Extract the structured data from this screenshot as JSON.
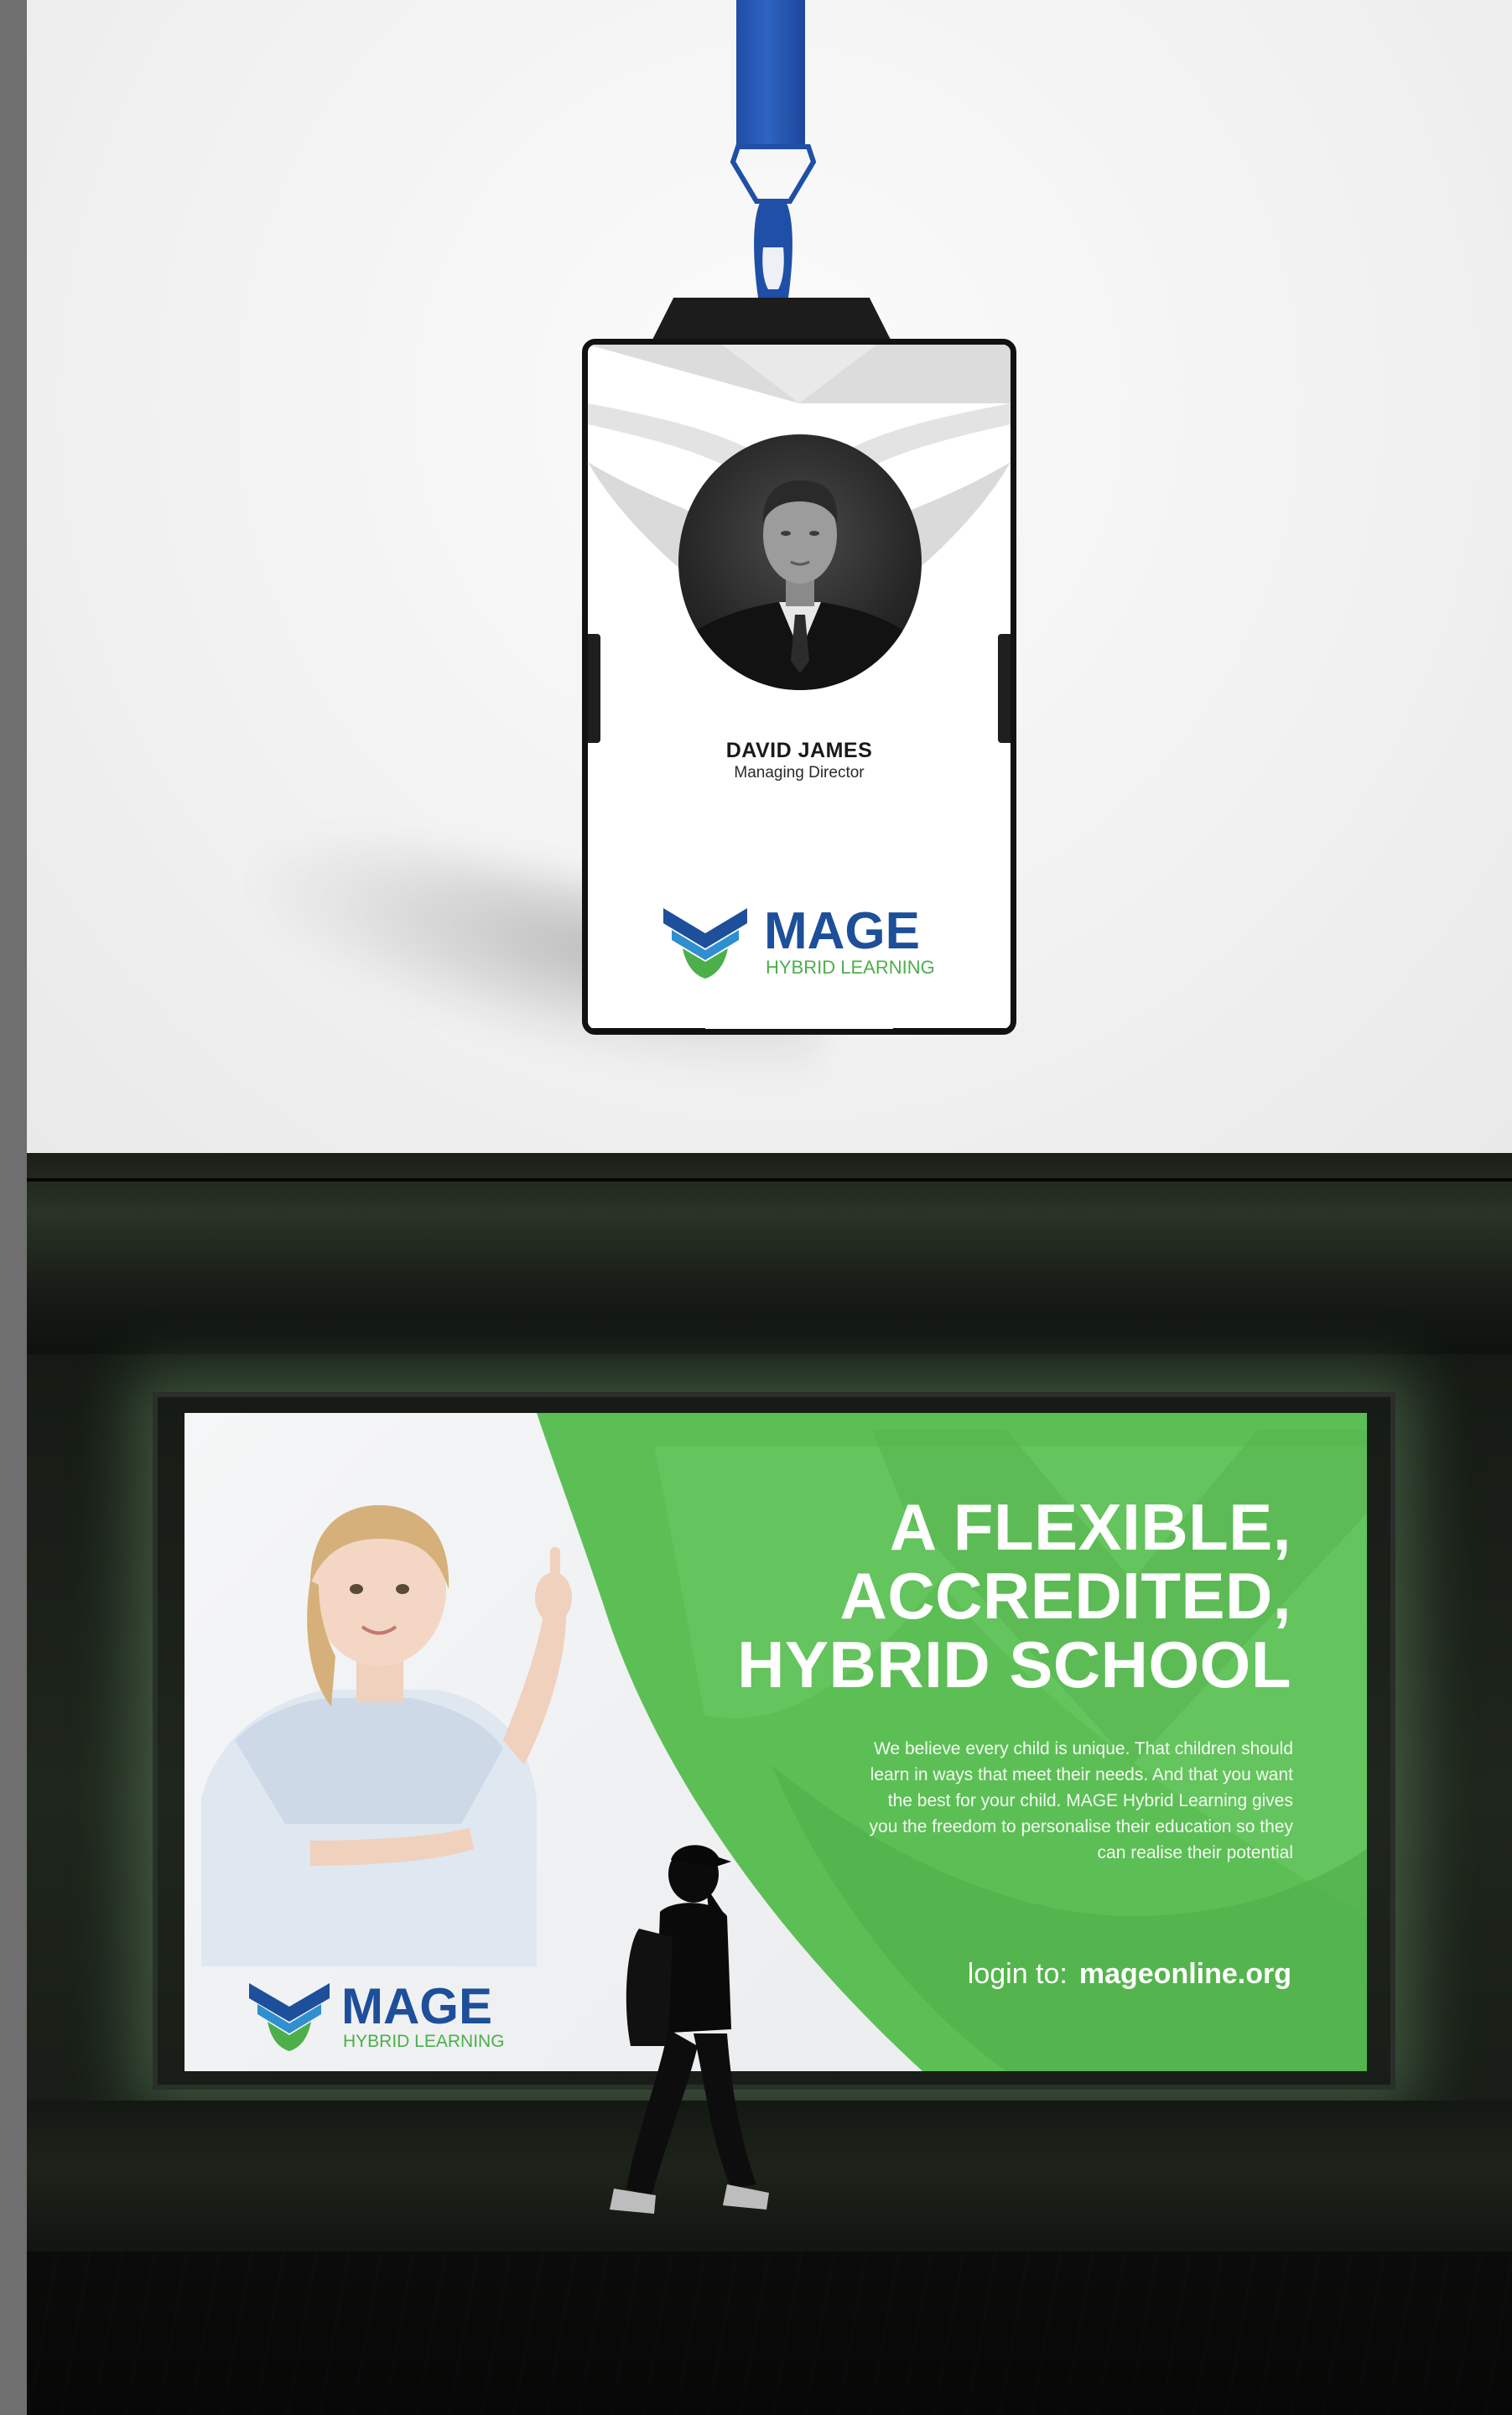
{
  "id_card": {
    "name": "DAVID JAMES",
    "title": "Managing Director",
    "logo_word": "MAGE",
    "logo_sub": "HYBRID LEARNING"
  },
  "billboard": {
    "headline": [
      "A FLEXIBLE,",
      "ACCREDITED,",
      "HYBRID SCHOOL"
    ],
    "body_lines": [
      "We believe every child is unique. That children should",
      "learn in ways that meet their needs. And that you want",
      "the best for your child. MAGE Hybrid Learning gives",
      "you the freedom to personalise their education so they",
      "can realise their potential"
    ],
    "login_label": "login to:",
    "login_url": "mageonline.org",
    "logo_word": "MAGE",
    "logo_sub": "HYBRID LEARNING"
  },
  "colors": {
    "brand_blue": "#1d4f9a",
    "brand_green": "#4caf4a",
    "lanyard_blue": "#2a5db8",
    "billboard_green": "#5cbf55"
  },
  "icons": [
    "mage-logo-icon"
  ]
}
